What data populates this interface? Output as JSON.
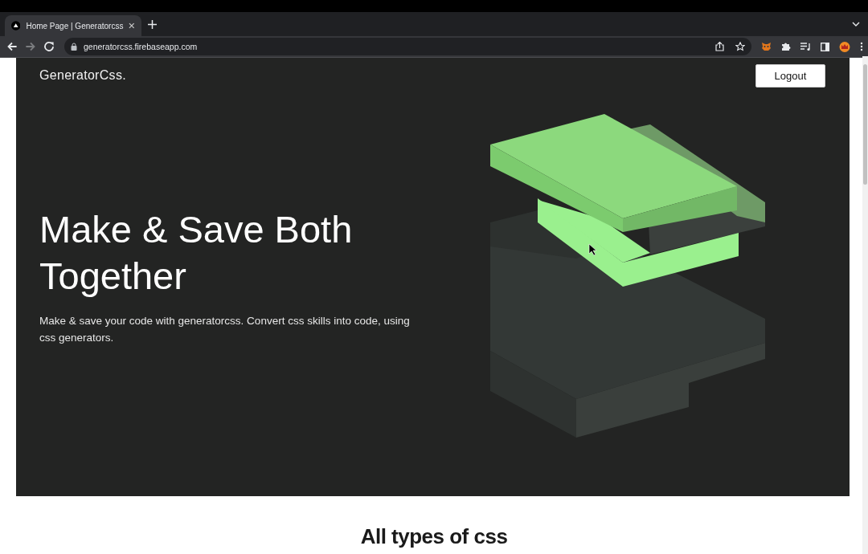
{
  "browser": {
    "tabs": [
      {
        "title": "Home Page | Generatorcss",
        "selected": true
      }
    ],
    "nav": [
      {
        "kind": "back",
        "disabled": false
      },
      {
        "kind": "forward",
        "disabled": true
      },
      {
        "kind": "reload",
        "disabled": false
      }
    ],
    "url": "generatorcss.firebaseapp.com"
  },
  "page": {
    "logo": "GeneratorCss.",
    "logout_button": "Logout",
    "hero_title": "Make & Save Both Together",
    "hero_text": "Make & save your code with generatorcss. Convert css skills into code, using css generators.",
    "section_heading": "All types of css"
  }
}
